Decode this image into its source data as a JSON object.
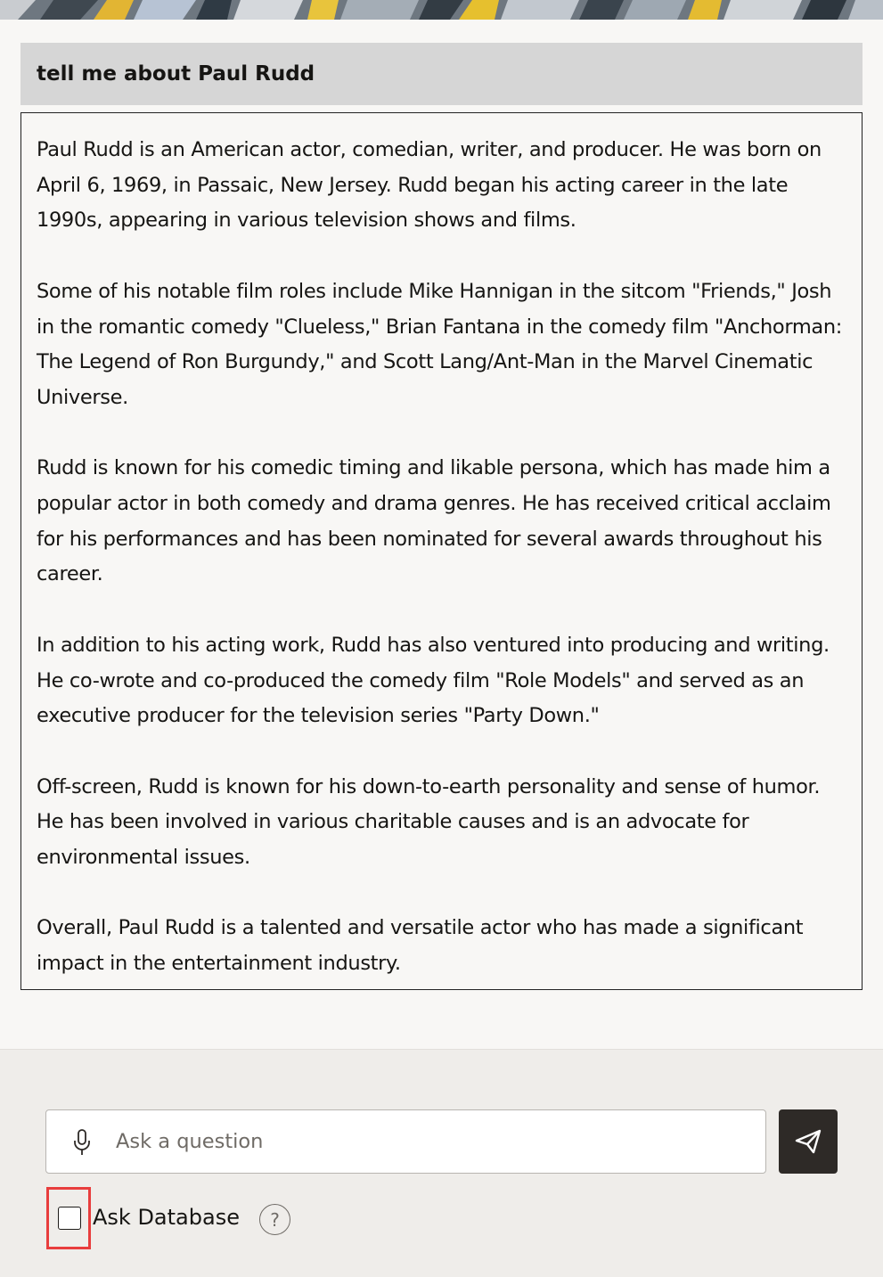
{
  "conversation": {
    "question": "tell me about Paul Rudd",
    "answer_paragraphs": [
      "Paul Rudd is an American actor, comedian, writer, and producer. He was born on April 6, 1969, in Passaic, New Jersey. Rudd began his acting career in the late 1990s, appearing in various television shows and films.",
      "Some of his notable film roles include Mike Hannigan in the sitcom \"Friends,\" Josh in the romantic comedy \"Clueless,\" Brian Fantana in the comedy film \"Anchorman: The Legend of Ron Burgundy,\" and Scott Lang/Ant-Man in the Marvel Cinematic Universe.",
      "Rudd is known for his comedic timing and likable persona, which has made him a popular actor in both comedy and drama genres. He has received critical acclaim for his performances and has been nominated for several awards throughout his career.",
      "In addition to his acting work, Rudd has also ventured into producing and writing. He co-wrote and co-produced the comedy film \"Role Models\" and served as an executive producer for the television series \"Party Down.\"",
      "Off-screen, Rudd is known for his down-to-earth personality and sense of humor. He has been involved in various charitable causes and is an advocate for environmental issues.",
      "Overall, Paul Rudd is a talented and versatile actor who has made a significant impact in the entertainment industry."
    ]
  },
  "input": {
    "placeholder": "Ask a question",
    "value": "",
    "mic_icon": "microphone-icon",
    "send_icon": "paper-plane-icon"
  },
  "options": {
    "ask_database_label": "Ask Database",
    "ask_database_checked": false,
    "help_glyph": "?"
  },
  "colors": {
    "question_background": "#d6d6d6",
    "send_button": "#2e2a27",
    "highlight": "#e83d3d"
  }
}
